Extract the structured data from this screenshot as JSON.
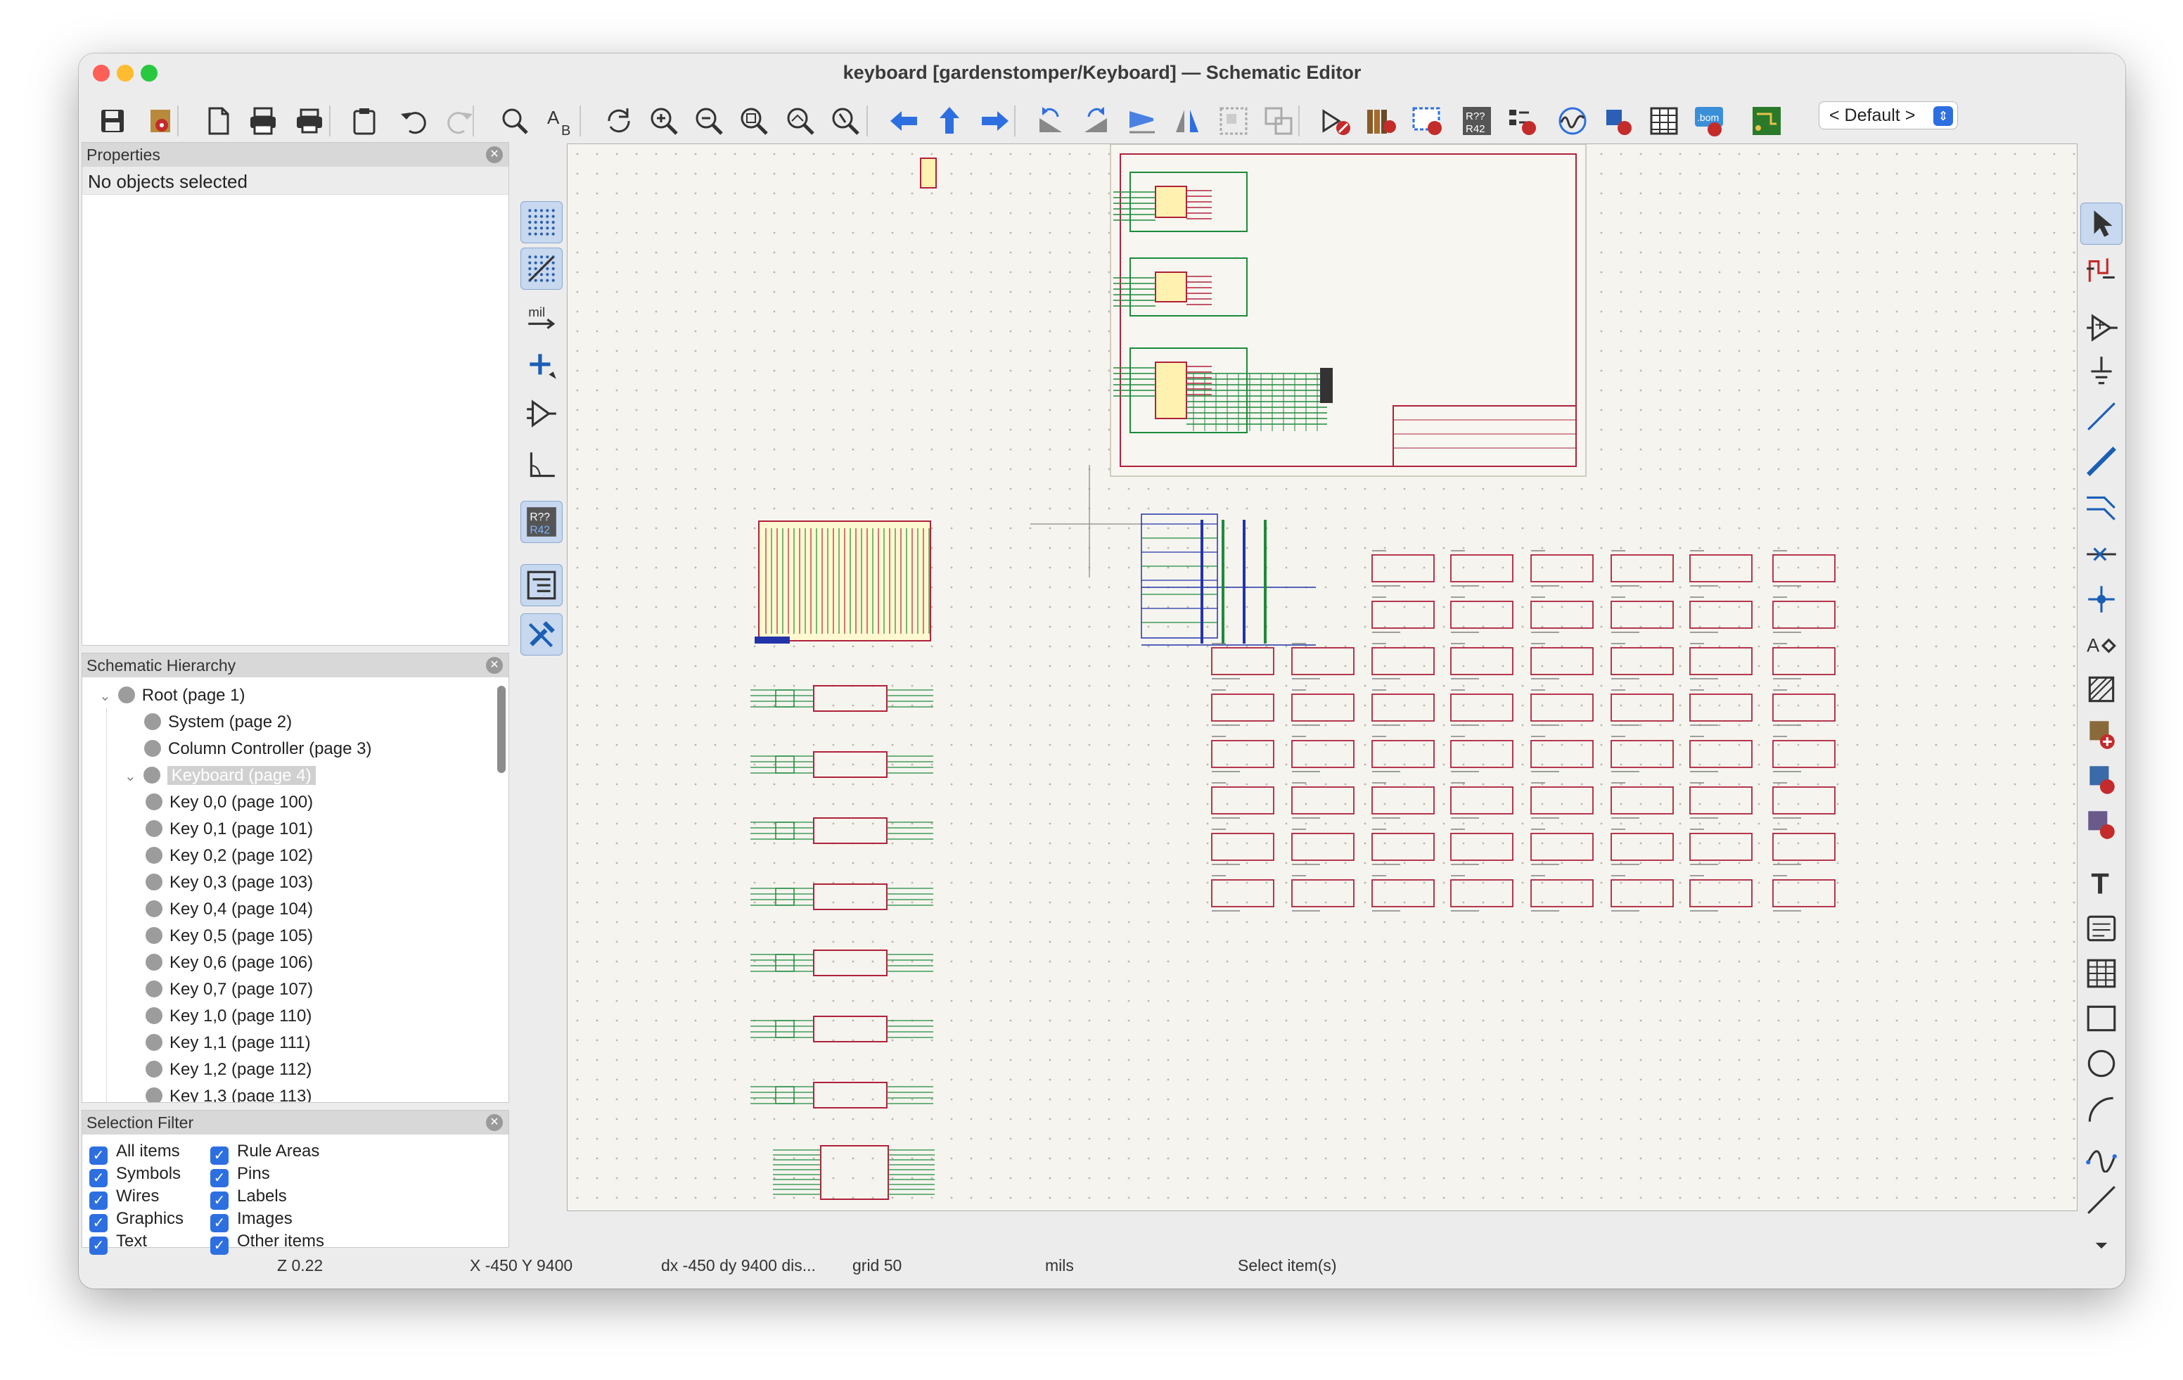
{
  "window": {
    "title": "keyboard [gardenstomper/Keyboard] — Schematic Editor"
  },
  "toolbar": {
    "buttons": [
      "save-icon",
      "schematic-setup-icon",
      "page-settings-icon",
      "print-icon",
      "plot-icon",
      "paste-icon",
      "undo-icon",
      "redo-icon",
      "find-icon",
      "find-replace-icon",
      "refresh-icon",
      "zoom-in-icon",
      "zoom-out-icon",
      "zoom-fit-icon",
      "zoom-objects-icon",
      "zoom-selection-icon",
      "navigate-back-icon",
      "navigate-up-icon",
      "navigate-forward-icon",
      "rotate-ccw-icon",
      "rotate-cw-icon",
      "mirror-vertical-icon",
      "mirror-horizontal-icon",
      "group-icon",
      "ungroup-icon",
      "symbol-editor-icon",
      "symbol-browser-icon",
      "symbol-fields-table-icon",
      "annotate-icon",
      "erc-icon",
      "simulator-icon",
      "footprint-assign-icon",
      "bom-table-icon",
      "bom-export-icon",
      "pcb-editor-icon"
    ],
    "variant_select": "< Default >"
  },
  "properties": {
    "title": "Properties",
    "empty_text": "No objects selected"
  },
  "hierarchy": {
    "title": "Schematic Hierarchy",
    "items": [
      {
        "label": "Root (page 1)",
        "level": 0,
        "selected": false
      },
      {
        "label": "System (page 2)",
        "level": 1,
        "selected": false
      },
      {
        "label": "Column Controller (page 3)",
        "level": 1,
        "selected": false
      },
      {
        "label": "Keyboard (page 4)",
        "level": 1,
        "selected": true
      },
      {
        "label": "Key 0,0 (page 100)",
        "level": 2,
        "selected": false
      },
      {
        "label": "Key 0,1 (page 101)",
        "level": 2,
        "selected": false
      },
      {
        "label": "Key 0,2 (page 102)",
        "level": 2,
        "selected": false
      },
      {
        "label": "Key 0,3 (page 103)",
        "level": 2,
        "selected": false
      },
      {
        "label": "Key 0,4 (page 104)",
        "level": 2,
        "selected": false
      },
      {
        "label": "Key 0,5 (page 105)",
        "level": 2,
        "selected": false
      },
      {
        "label": "Key 0,6 (page 106)",
        "level": 2,
        "selected": false
      },
      {
        "label": "Key 0,7 (page 107)",
        "level": 2,
        "selected": false
      },
      {
        "label": "Key 1,0 (page 110)",
        "level": 2,
        "selected": false
      },
      {
        "label": "Key 1,1 (page 111)",
        "level": 2,
        "selected": false
      },
      {
        "label": "Key 1,2 (page 112)",
        "level": 2,
        "selected": false
      },
      {
        "label": "Key 1,3 (page 113)",
        "level": 2,
        "selected": false
      }
    ]
  },
  "selection_filter": {
    "title": "Selection Filter",
    "col1": [
      "All items",
      "Symbols",
      "Wires",
      "Graphics",
      "Text"
    ],
    "col2": [
      "Rule Areas",
      "Pins",
      "Labels",
      "Images",
      "Other items"
    ]
  },
  "left_tools": [
    "grid-dots-icon",
    "grid-overrides-icon",
    "units-mil-icon",
    "cursor-crosshair-icon",
    "hidden-pins-icon",
    "wire-angle-icon",
    "annotate-refs-icon",
    "hierarchy-panel-icon",
    "properties-panel-icon"
  ],
  "left_tools_label": "mil",
  "right_tools": [
    "select-icon",
    "highlight-net-icon",
    "add-symbol-icon",
    "add-power-icon",
    "add-wire-icon",
    "add-bus-icon",
    "add-bus-entry-icon",
    "no-connect-icon",
    "add-junction-icon",
    "add-label-icon",
    "add-rule-area-icon",
    "add-global-label-icon",
    "add-hier-label-icon",
    "add-sheet-pin-icon",
    "add-text-icon",
    "add-textbox-icon",
    "add-table-icon",
    "add-rectangle-icon",
    "add-circle-icon",
    "add-arc-icon",
    "add-bezier-icon",
    "add-line-icon",
    "more-tools-icon"
  ],
  "status": {
    "zoom": "Z 0.22",
    "cursor": "X -450  Y 9400",
    "delta": "dx -450  dy 9400  dis...",
    "grid": "grid 50",
    "units": "mils",
    "mode": "Select item(s)"
  },
  "colors": {
    "accent": "#2d6fe0",
    "canvas": "#f5f4ef",
    "sheet_border": "#b0223a",
    "wire": "#1f8a3a",
    "bus": "#2233aa",
    "traffic_close": "#fe5f57",
    "traffic_min": "#febc2e",
    "traffic_max": "#28c840"
  }
}
